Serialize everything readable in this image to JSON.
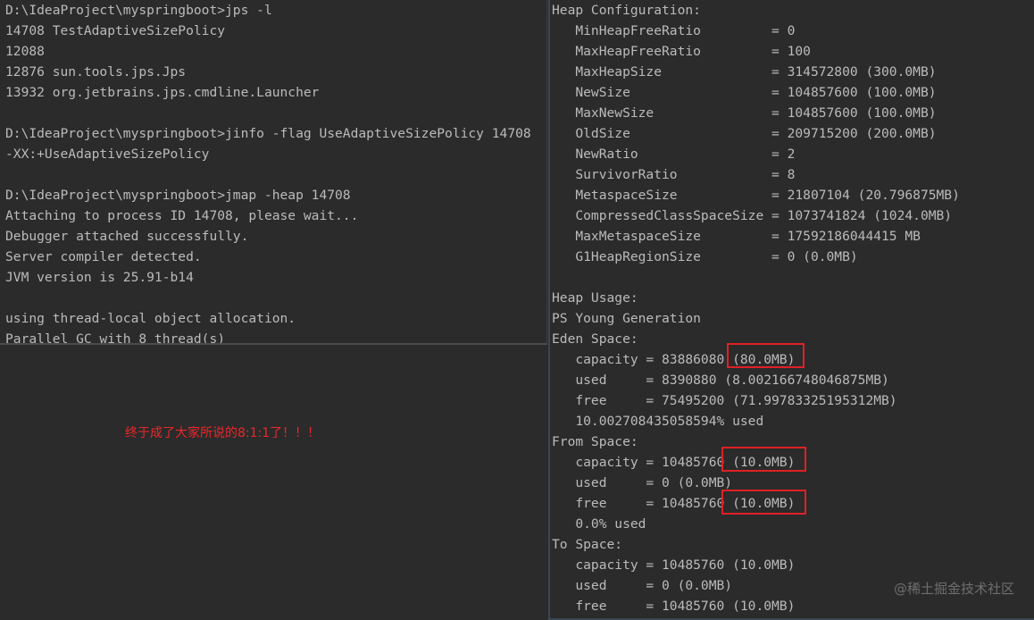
{
  "left_terminal": {
    "lines": [
      "D:\\IdeaProject\\myspringboot>jps -l",
      "14708 TestAdaptiveSizePolicy",
      "12088",
      "12876 sun.tools.jps.Jps",
      "13932 org.jetbrains.jps.cmdline.Launcher",
      "",
      "D:\\IdeaProject\\myspringboot>jinfo -flag UseAdaptiveSizePolicy 14708",
      "-XX:+UseAdaptiveSizePolicy",
      "",
      "D:\\IdeaProject\\myspringboot>jmap -heap 14708",
      "Attaching to process ID 14708, please wait...",
      "Debugger attached successfully.",
      "Server compiler detected.",
      "JVM version is 25.91-b14",
      "",
      "using thread-local object allocation.",
      "Parallel GC with 8 thread(s)"
    ]
  },
  "right_terminal": {
    "lines": [
      "Heap Configuration:",
      "   MinHeapFreeRatio         = 0",
      "   MaxHeapFreeRatio         = 100",
      "   MaxHeapSize              = 314572800 (300.0MB)",
      "   NewSize                  = 104857600 (100.0MB)",
      "   MaxNewSize               = 104857600 (100.0MB)",
      "   OldSize                  = 209715200 (200.0MB)",
      "   NewRatio                 = 2",
      "   SurvivorRatio            = 8",
      "   MetaspaceSize            = 21807104 (20.796875MB)",
      "   CompressedClassSpaceSize = 1073741824 (1024.0MB)",
      "   MaxMetaspaceSize         = 17592186044415 MB",
      "   G1HeapRegionSize         = 0 (0.0MB)",
      "",
      "Heap Usage:",
      "PS Young Generation",
      "Eden Space:",
      "   capacity = 83886080 (80.0MB)",
      "   used     = 8390880 (8.002166748046875MB)",
      "   free     = 75495200 (71.99783325195312MB)",
      "   10.002708435058594% used",
      "From Space:",
      "   capacity = 10485760 (10.0MB)",
      "   used     = 0 (0.0MB)",
      "   free     = 10485760 (10.0MB)",
      "   0.0% used",
      "To Space:",
      "   capacity = 10485760 (10.0MB)",
      "   used     = 0 (0.0MB)",
      "   free     = 10485760 (10.0MB)"
    ]
  },
  "annotation": "终于成了大家所说的8:1:1了！！！",
  "watermark": "@稀土掘金技术社区",
  "colors": {
    "background": "#2b2b2b",
    "text": "#bbbbbb",
    "highlight": "#e02025",
    "annotation": "#e8282b"
  }
}
